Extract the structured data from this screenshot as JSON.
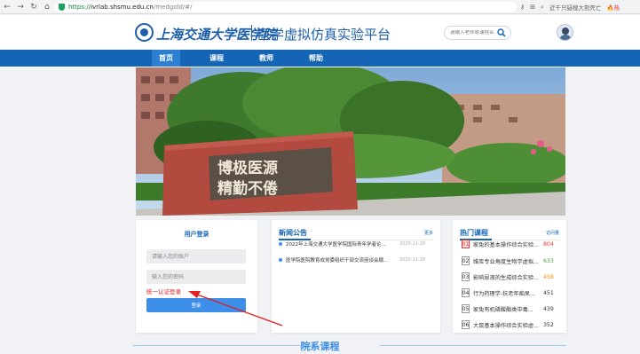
{
  "browser": {
    "url_scheme": "https://",
    "url_host": "ivrlab.shsmu.edu.cn",
    "url_path": "/medgold/#/",
    "search_hint": "近千只疑搜大熊死亡",
    "hot_badge": "🔥热"
  },
  "header": {
    "school_name": "上海交通大学医学院",
    "platform_title": "医学虚拟仿真实验平台",
    "search_placeholder": "请输入老师或课程名"
  },
  "nav": {
    "items": [
      {
        "label": "首页",
        "active": true
      },
      {
        "label": "课程",
        "active": false
      },
      {
        "label": "教师",
        "active": false
      },
      {
        "label": "帮助",
        "active": false
      }
    ]
  },
  "banner": {
    "stone_text_line1": "博极医源",
    "stone_text_line2": "精勤不倦"
  },
  "login": {
    "title": "用户登录",
    "account_placeholder": "请输入您的账户",
    "password_placeholder": "输入您的密码",
    "unified_auth_link": "统一认证登录",
    "login_button": "登录"
  },
  "news": {
    "title": "新闻公告",
    "more": "更多",
    "items": [
      {
        "text": "2022年上海交通大学医学院国际青年学者论坛...",
        "date": "2020-11-29"
      },
      {
        "text": "医学院医院教育成党委组织干部交流座谈会顺...",
        "date": "2020-11-28"
      }
    ]
  },
  "hot_courses": {
    "title": "热门课程",
    "more": "访问量",
    "items": [
      {
        "rank": "01",
        "name": "家兔的基本操作综合实验...",
        "count": "804",
        "count_color": "#e53935"
      },
      {
        "rank": "02",
        "name": "维库专业角度生物学虚拟...",
        "count": "633",
        "count_color": "#43a047"
      },
      {
        "rank": "03",
        "name": "影响尿液的生成综合实验...",
        "count": "458",
        "count_color": "#fb8c00"
      },
      {
        "rank": "04",
        "name": "行为药理学-抗老年痴呆...",
        "count": "451",
        "count_color": "#333333"
      },
      {
        "rank": "05",
        "name": "家兔有机磷酸酯类中毒...",
        "count": "439",
        "count_color": "#333333"
      },
      {
        "rank": "06",
        "name": "大鼠基本操作综合实验虚...",
        "count": "352",
        "count_color": "#333333"
      }
    ]
  },
  "section": {
    "title": "院系课程"
  },
  "colors": {
    "brand_blue": "#1565b6",
    "accent_blue": "#3d8ee8",
    "link_red": "#e02020"
  }
}
